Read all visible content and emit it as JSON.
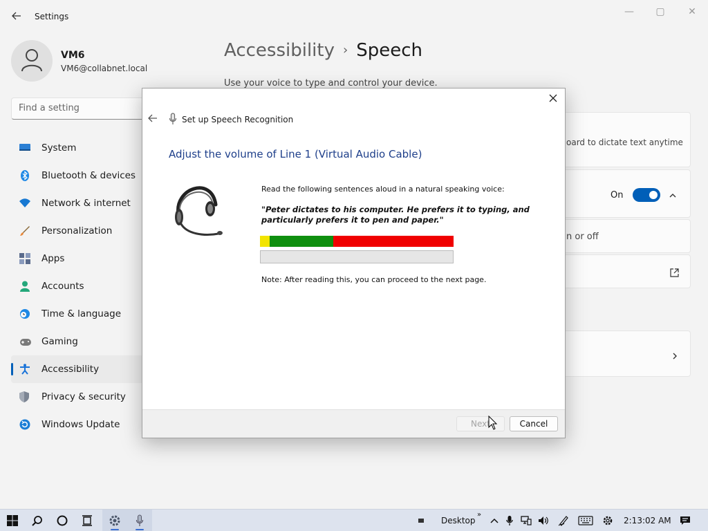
{
  "window": {
    "title": "Settings",
    "back_icon": "back-arrow-icon",
    "minimize_glyph": "—",
    "maximize_glyph": "▢",
    "close_glyph": "✕"
  },
  "profile": {
    "name": "VM6",
    "email": "VM6@collabnet.local"
  },
  "search": {
    "placeholder": "Find a setting"
  },
  "sidebar": {
    "items": [
      {
        "label": "System",
        "icon": "system-icon",
        "color": "#2b7fd4"
      },
      {
        "label": "Bluetooth & devices",
        "icon": "bluetooth-icon",
        "color": "#1e88e5"
      },
      {
        "label": "Network & internet",
        "icon": "wifi-icon",
        "color": "#1778d2"
      },
      {
        "label": "Personalization",
        "icon": "brush-icon",
        "color": "#e8883a"
      },
      {
        "label": "Apps",
        "icon": "apps-icon",
        "color": "#5a6b8c"
      },
      {
        "label": "Accounts",
        "icon": "accounts-icon",
        "color": "#23a77a"
      },
      {
        "label": "Time & language",
        "icon": "clock-globe-icon",
        "color": "#1e88e5"
      },
      {
        "label": "Gaming",
        "icon": "gamepad-icon",
        "color": "#7a7a7a"
      },
      {
        "label": "Accessibility",
        "icon": "accessibility-icon",
        "color": "#1a73d8"
      },
      {
        "label": "Privacy & security",
        "icon": "shield-icon",
        "color": "#7c8593"
      },
      {
        "label": "Windows Update",
        "icon": "update-icon",
        "color": "#1c7ed6"
      }
    ],
    "active_index": 8
  },
  "page": {
    "breadcrumb_parent": "Accessibility",
    "breadcrumb_separator": "›",
    "breadcrumb_current": "Speech",
    "subtitle": "Use your voice to type and control your device."
  },
  "background_cards": {
    "card1_text": "oard to dictate text anytime",
    "toggle_label": "On",
    "toggle_state": true,
    "card3_text": "n or off",
    "accent": "#005fb8"
  },
  "dialog": {
    "title": "Set up Speech Recognition",
    "heading": "Adjust the volume of Line 1 (Virtual Audio Cable)",
    "instructions": "Read the following sentences aloud in a natural speaking voice:",
    "quote": "\"Peter dictates to his computer. He prefers it to typing, and particularly prefers it to pen and paper.\"",
    "note": "Note: After reading this, you can proceed to the next page.",
    "meter_segments": [
      {
        "zone": "low",
        "fraction": 0.05,
        "color": "#f2e400"
      },
      {
        "zone": "good",
        "fraction": 0.33,
        "color": "#0f8f0f"
      },
      {
        "zone": "loud",
        "fraction": 0.62,
        "color": "#f00000"
      }
    ],
    "volume_level": 0.0,
    "next_label": "Next",
    "next_enabled": false,
    "cancel_label": "Cancel"
  },
  "taskbar": {
    "start_icon": "windows-logo-icon",
    "desktop_label": "Desktop",
    "overflow_glyph": "»",
    "time": "2:13:02 AM"
  }
}
